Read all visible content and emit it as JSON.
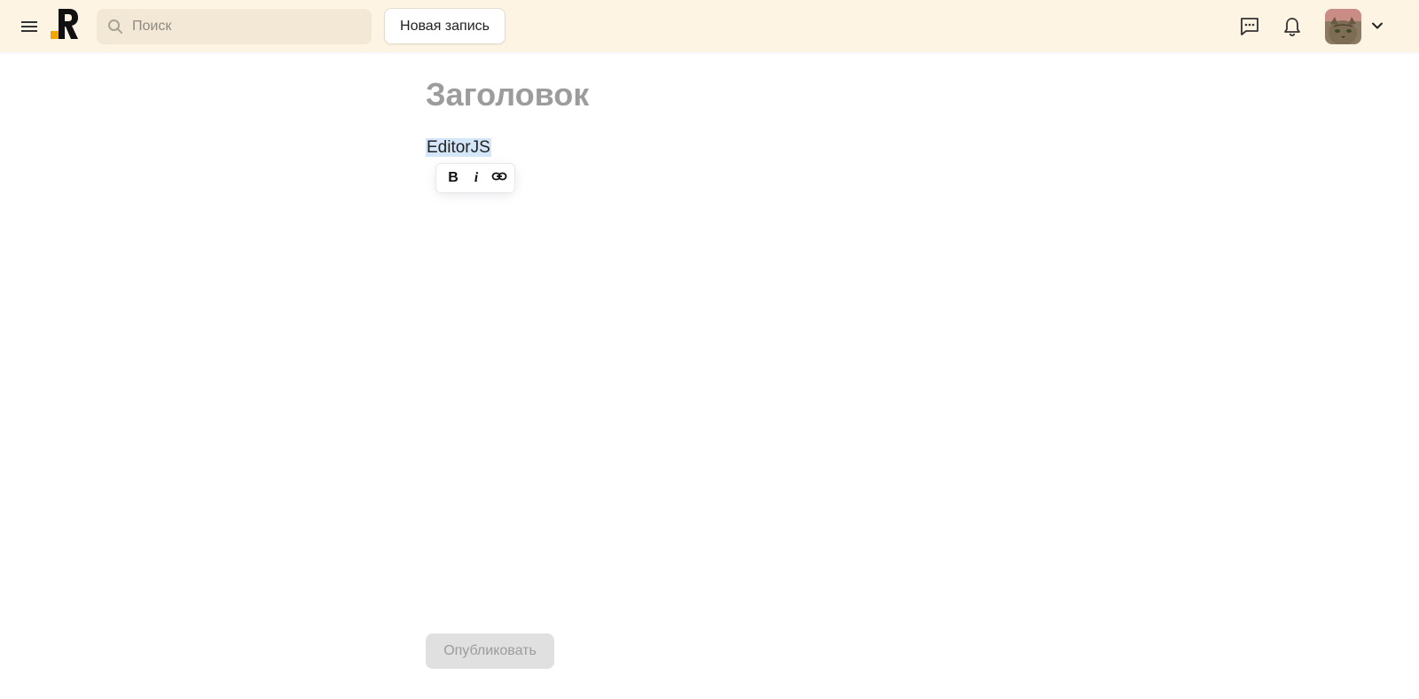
{
  "header": {
    "search": {
      "placeholder": "Поиск"
    },
    "new_post_label": "Новая запись",
    "icons": [
      "menu-icon",
      "logo",
      "search-icon",
      "messages-icon",
      "bell-icon",
      "avatar",
      "chevron-down-icon"
    ]
  },
  "editor": {
    "title_placeholder": "Заголовок",
    "paragraph_text": "EditorJS",
    "inline_toolbar": {
      "bold_label": "B",
      "italic_label": "i",
      "link_icon": "link-icon"
    }
  },
  "footer": {
    "publish_label": "Опубликовать"
  },
  "colors": {
    "header_bg": "#fef4e3",
    "search_bg": "#f3e8d6",
    "logo_accent": "#f0a500",
    "selection": "#d4e6f9",
    "publish_disabled_bg": "#e0e0e0"
  }
}
